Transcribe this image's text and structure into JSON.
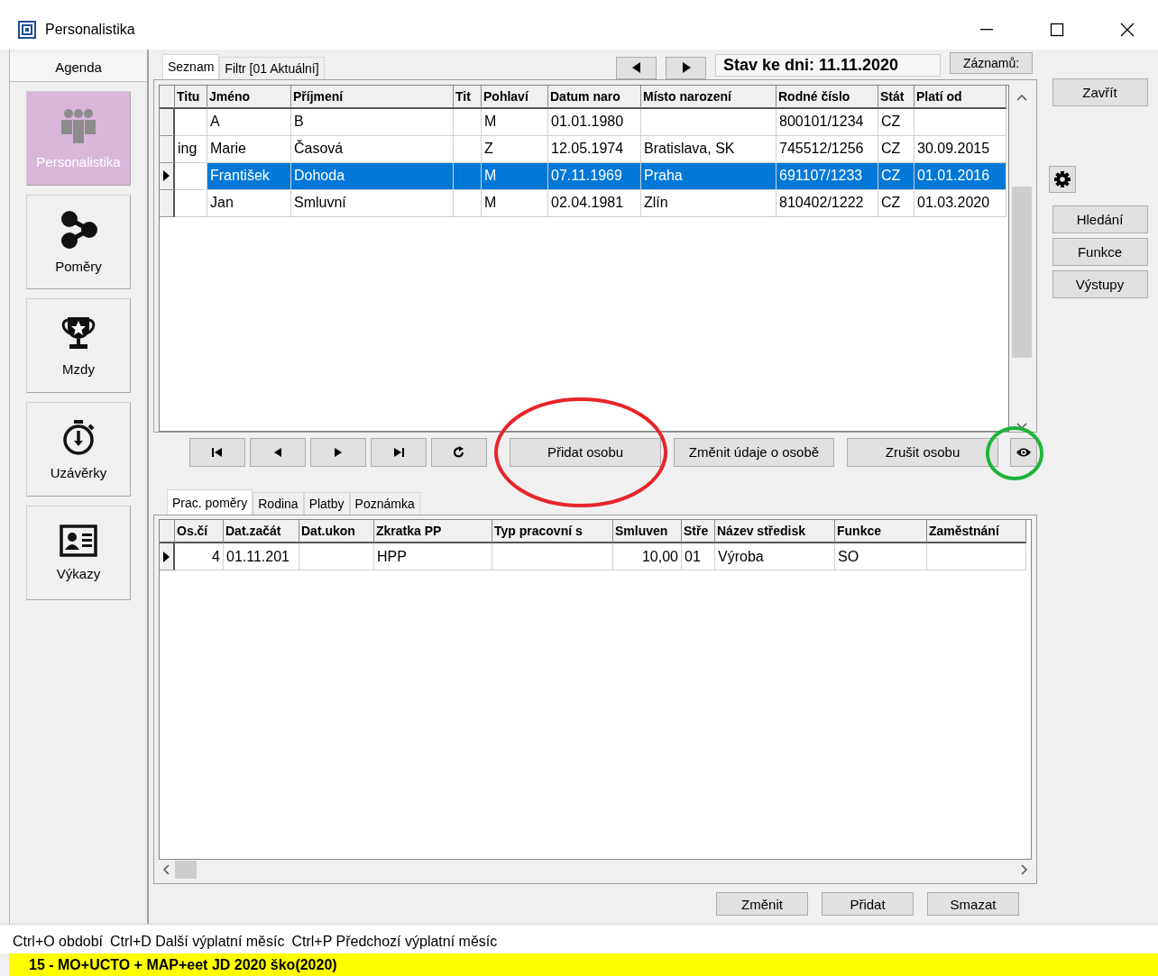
{
  "window": {
    "title": "Personalistika"
  },
  "sidebar": {
    "header": "Agenda",
    "items": [
      {
        "label": "Personalistika",
        "selected": true
      },
      {
        "label": "Poměry",
        "selected": false
      },
      {
        "label": "Mzdy",
        "selected": false
      },
      {
        "label": "Uzávěrky",
        "selected": false
      },
      {
        "label": "Výkazy",
        "selected": false
      }
    ]
  },
  "tabs": [
    {
      "label": "Seznam",
      "selected": true
    },
    {
      "label": "Filtr [01 Aktuální]",
      "selected": false
    }
  ],
  "status_date": "Stav ke dni: 11.11.2020",
  "records_button": "Záznamů:",
  "persons_table": {
    "columns": [
      "Titu",
      "Jméno",
      "Příjmení",
      "Tit",
      "Pohlaví",
      "Datum naro",
      "Místo narození",
      "Rodné číslo",
      "Stát",
      "Platí od"
    ],
    "rows": [
      {
        "selected": false,
        "cells": [
          "",
          "A",
          "B",
          "",
          "M",
          "01.01.1980",
          "",
          "800101/1234",
          "CZ",
          ""
        ]
      },
      {
        "selected": false,
        "cells": [
          "ing",
          "Marie",
          "Časová",
          "",
          "Z",
          "12.05.1974",
          "Bratislava, SK",
          "745512/1256",
          "CZ",
          "30.09.2015"
        ]
      },
      {
        "selected": true,
        "cells": [
          "",
          "František",
          "Dohoda",
          "",
          "M",
          "07.11.1969",
          "Praha",
          "691107/1233",
          "CZ",
          "01.01.2016"
        ]
      },
      {
        "selected": false,
        "cells": [
          "",
          "Jan",
          "Smluvní",
          "",
          "M",
          "02.04.1981",
          "Zlín",
          "810402/1222",
          "CZ",
          "01.03.2020"
        ]
      }
    ]
  },
  "person_actions": [
    "Přidat osobu",
    "Změnit údaje o osobě",
    "Zrušit osobu"
  ],
  "detail_tabs": [
    {
      "label": "Prac. poměry",
      "selected": true
    },
    {
      "label": "Rodina",
      "selected": false
    },
    {
      "label": "Platby",
      "selected": false
    },
    {
      "label": "Poznámka",
      "selected": false
    }
  ],
  "detail_table": {
    "columns": [
      "Os.čí",
      "Dat.začát",
      "Dat.ukon",
      "Zkratka PP",
      "Typ pracovní s",
      "Smluven",
      "Stře",
      "Název středisk",
      "Funkce",
      "Zaměstnání"
    ],
    "rows": [
      {
        "current": true,
        "cells": [
          "4",
          "01.11.201",
          "",
          "HPP",
          "",
          "10,00",
          "01",
          "Výroba",
          "SO",
          ""
        ]
      }
    ]
  },
  "detail_actions": [
    "Změnit",
    "Přidat",
    "Smazat"
  ],
  "right_panel": {
    "close": "Zavřít",
    "buttons": [
      "Hledání",
      "Funkce",
      "Výstupy"
    ]
  },
  "shortcuts": [
    "Ctrl+O období",
    "Ctrl+D Další výplatní měsíc",
    "Ctrl+P Předchozí výplatní měsíc"
  ],
  "status_bar": "15 - MO+UCTO + MAP+eet  JD 2020 ško(2020)"
}
